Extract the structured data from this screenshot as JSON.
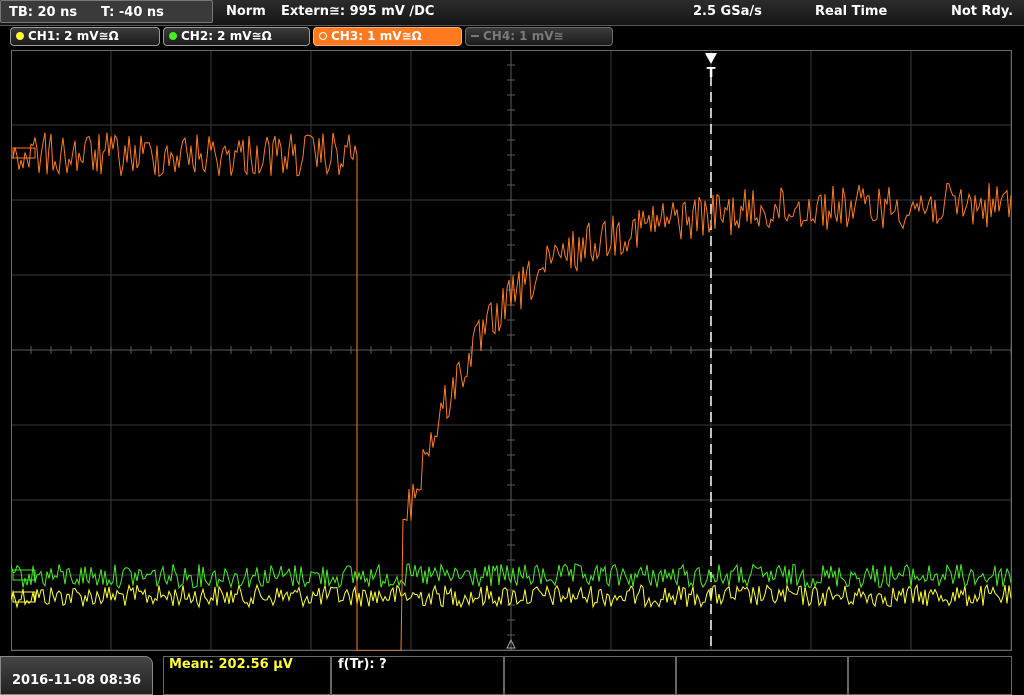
{
  "header": {
    "timebase": "TB: 20 ns",
    "trigger_offset": "T: -40 ns",
    "acq_mode": "Norm",
    "trigger_source": "Extern≅: 995 mV ∕DC",
    "sample_rate": "2.5 GSa/s",
    "sampling": "Real Time",
    "status": "Not Rdy."
  },
  "channels": [
    {
      "label": "CH1: 2 mV≅Ω",
      "color": "#ffff33",
      "state": "on"
    },
    {
      "label": "CH2: 2 mV≅Ω",
      "color": "#44ee22",
      "state": "on"
    },
    {
      "label": "CH3: 1 mV≅Ω",
      "color": "#ff7a1e",
      "state": "selected"
    },
    {
      "label": "CH4: 1 mV≅",
      "color": "#777777",
      "state": "off"
    }
  ],
  "trigger_marker": "T",
  "footer": {
    "datetime": "2016-11-08 08:36",
    "measurement_1": "Mean: 202.56 µV",
    "measurement_2": "f(Tr): ?"
  },
  "icons": [
    "channel-dot-icon",
    "trigger-position-icon",
    "channel-ground-marker-icon"
  ],
  "colors": {
    "ch1": "#ffff33",
    "ch2": "#44ee22",
    "ch3": "#ff7a1e",
    "grid": "#3a3a3a"
  }
}
